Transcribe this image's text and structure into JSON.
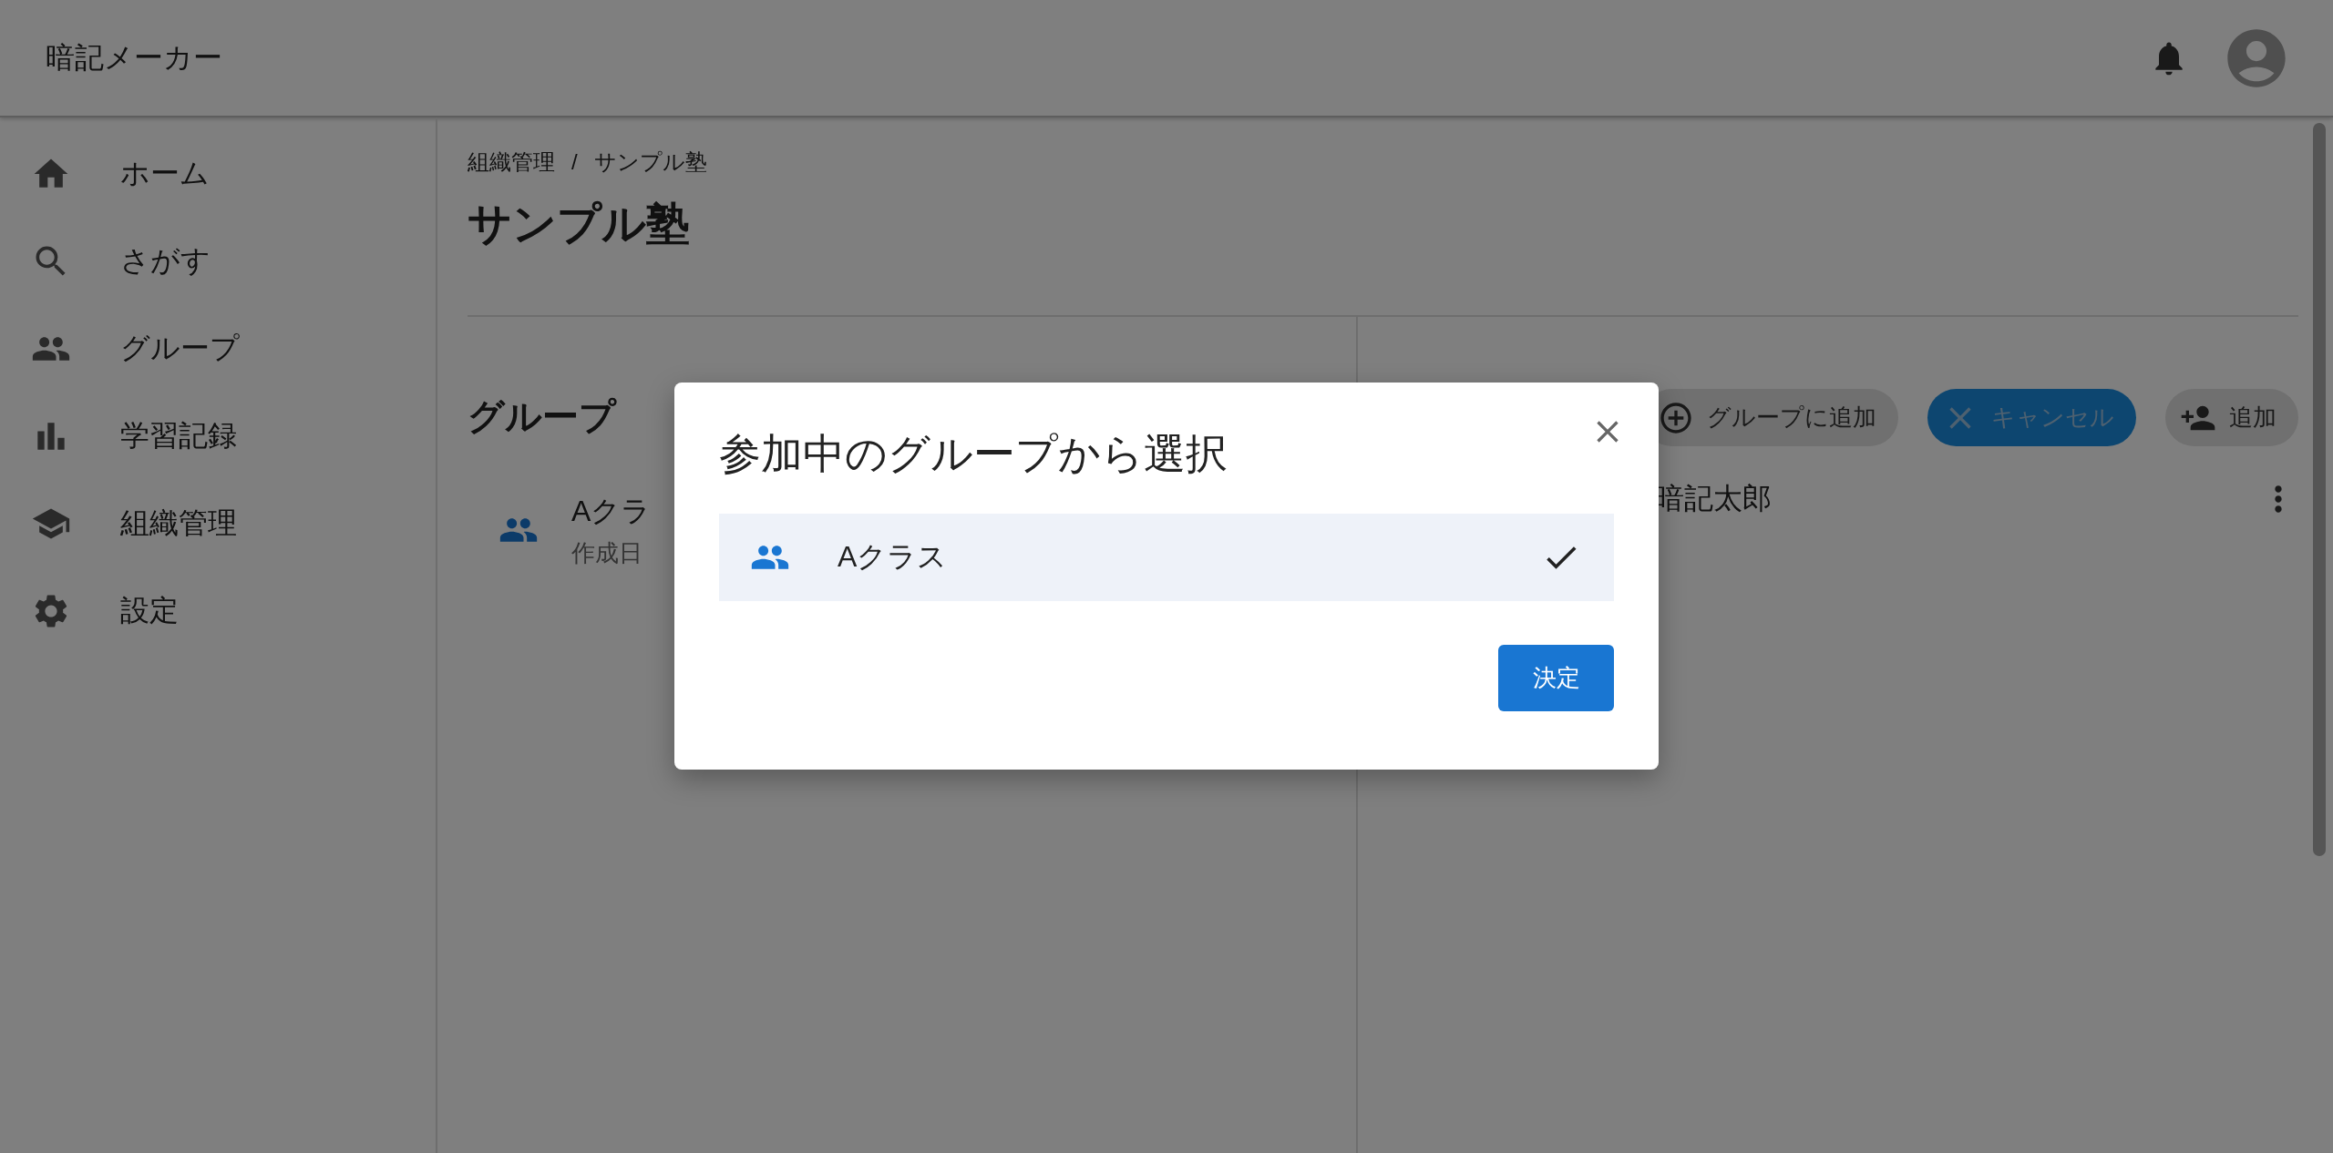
{
  "app_bar": {
    "title": "暗記メーカー"
  },
  "sidebar": {
    "items": [
      {
        "label": "ホーム"
      },
      {
        "label": "さがす"
      },
      {
        "label": "グループ"
      },
      {
        "label": "学習記録"
      },
      {
        "label": "組織管理"
      },
      {
        "label": "設定"
      }
    ]
  },
  "breadcrumbs": {
    "items": [
      "組織管理",
      "サンプル塾"
    ],
    "separator": "/"
  },
  "page_title": "サンプル塾",
  "groups": {
    "title": "グループ",
    "items": [
      {
        "name": "Aクラ",
        "meta": "作成日"
      }
    ]
  },
  "members": {
    "buttons": [
      {
        "label": "グループに追加",
        "kind": "add-group"
      },
      {
        "label": "キャンセル",
        "kind": "cancel"
      },
      {
        "label": "追加",
        "kind": "add-person"
      }
    ],
    "items": [
      {
        "name": "暗記太郎"
      }
    ]
  },
  "dialog": {
    "title": "参加中のグループから選択",
    "items": [
      {
        "label": "Aクラス",
        "selected": true
      }
    ],
    "confirm": "決定"
  }
}
